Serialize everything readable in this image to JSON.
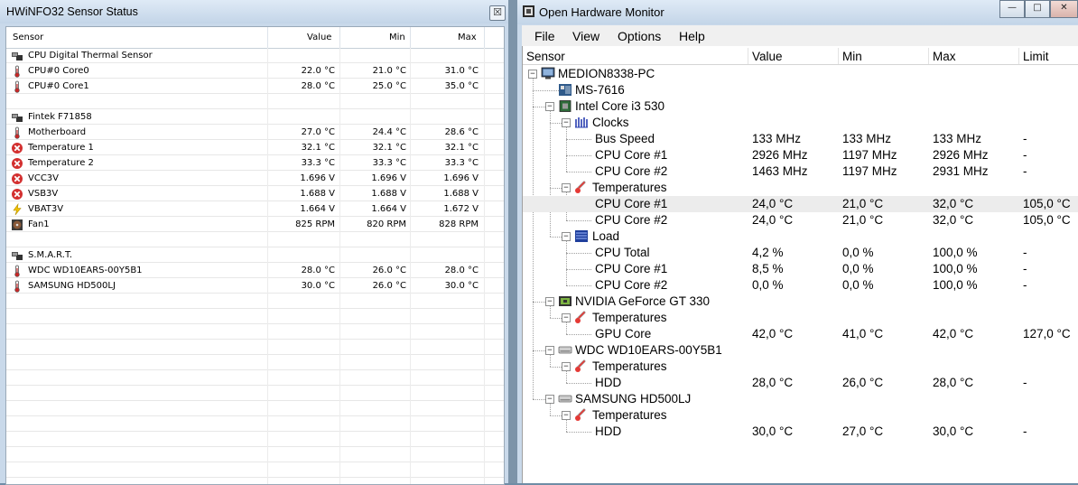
{
  "hwinfo": {
    "title": "HWiNFO32 Sensor Status",
    "close_glyph": "☒",
    "columns": [
      "Sensor",
      "Value",
      "Min",
      "Max"
    ],
    "rows": [
      {
        "icon": "chip-group-icon",
        "name": "CPU Digital Thermal Sensor",
        "value": "",
        "min": "",
        "max": ""
      },
      {
        "icon": "thermometer-icon",
        "name": "CPU#0 Core0",
        "value": "22.0 °C",
        "min": "21.0 °C",
        "max": "31.0 °C"
      },
      {
        "icon": "thermometer-icon",
        "name": "CPU#0 Core1",
        "value": "28.0 °C",
        "min": "25.0 °C",
        "max": "35.0 °C"
      },
      {
        "icon": "",
        "name": "",
        "value": "",
        "min": "",
        "max": ""
      },
      {
        "icon": "chip-group-icon",
        "name": "Fintek F71858",
        "value": "",
        "min": "",
        "max": ""
      },
      {
        "icon": "thermometer-icon",
        "name": "Motherboard",
        "value": "27.0 °C",
        "min": "24.4 °C",
        "max": "28.6 °C"
      },
      {
        "icon": "alert-icon",
        "name": "Temperature 1",
        "value": "32.1 °C",
        "min": "32.1 °C",
        "max": "32.1 °C"
      },
      {
        "icon": "alert-icon",
        "name": "Temperature 2",
        "value": "33.3 °C",
        "min": "33.3 °C",
        "max": "33.3 °C"
      },
      {
        "icon": "alert-icon",
        "name": "VCC3V",
        "value": "1.696 V",
        "min": "1.696 V",
        "max": "1.696 V"
      },
      {
        "icon": "alert-icon",
        "name": "VSB3V",
        "value": "1.688 V",
        "min": "1.688 V",
        "max": "1.688 V"
      },
      {
        "icon": "voltage-icon",
        "name": "VBAT3V",
        "value": "1.664 V",
        "min": "1.664 V",
        "max": "1.672 V"
      },
      {
        "icon": "fan-icon",
        "name": "Fan1",
        "value": "825 RPM",
        "min": "820 RPM",
        "max": "828 RPM"
      },
      {
        "icon": "",
        "name": "",
        "value": "",
        "min": "",
        "max": ""
      },
      {
        "icon": "chip-group-icon",
        "name": "S.M.A.R.T.",
        "value": "",
        "min": "",
        "max": ""
      },
      {
        "icon": "thermometer-icon",
        "name": "WDC WD10EARS-00Y5B1",
        "value": "28.0 °C",
        "min": "26.0 °C",
        "max": "28.0 °C"
      },
      {
        "icon": "thermometer-icon",
        "name": "SAMSUNG HD500LJ",
        "value": "30.0 °C",
        "min": "26.0 °C",
        "max": "30.0 °C"
      }
    ]
  },
  "ohm": {
    "title": "Open Hardware Monitor",
    "window_buttons": [
      "—",
      "□",
      "✕"
    ],
    "menu": [
      "File",
      "View",
      "Options",
      "Help"
    ],
    "columns": [
      "Sensor",
      "Value",
      "Min",
      "Max",
      "Limit"
    ],
    "rows": [
      {
        "level": 0,
        "expander": "−",
        "icon": "computer-icon",
        "name": "MEDION8338-PC",
        "value": "",
        "min": "",
        "max": "",
        "limit": "",
        "selected": false
      },
      {
        "level": 1,
        "expander": "",
        "icon": "mainboard-icon",
        "name": "MS-7616",
        "value": "",
        "min": "",
        "max": "",
        "limit": "",
        "selected": false
      },
      {
        "level": 1,
        "expander": "−",
        "icon": "cpu-icon",
        "name": "Intel Core i3 530",
        "value": "",
        "min": "",
        "max": "",
        "limit": "",
        "selected": false
      },
      {
        "level": 2,
        "expander": "−",
        "icon": "clock-icon",
        "name": "Clocks",
        "value": "",
        "min": "",
        "max": "",
        "limit": "",
        "selected": false
      },
      {
        "level": 3,
        "expander": "",
        "icon": "",
        "name": "Bus Speed",
        "value": "133 MHz",
        "min": "133 MHz",
        "max": "133 MHz",
        "limit": "-",
        "selected": false
      },
      {
        "level": 3,
        "expander": "",
        "icon": "",
        "name": "CPU Core #1",
        "value": "2926 MHz",
        "min": "1197 MHz",
        "max": "2926 MHz",
        "limit": "-",
        "selected": false
      },
      {
        "level": 3,
        "expander": "",
        "icon": "",
        "name": "CPU Core #2",
        "value": "1463 MHz",
        "min": "1197 MHz",
        "max": "2931 MHz",
        "limit": "-",
        "selected": false
      },
      {
        "level": 2,
        "expander": "−",
        "icon": "thermometer-icon",
        "name": "Temperatures",
        "value": "",
        "min": "",
        "max": "",
        "limit": "",
        "selected": false
      },
      {
        "level": 3,
        "expander": "",
        "icon": "",
        "name": "CPU Core #1",
        "value": "24,0 °C",
        "min": "21,0 °C",
        "max": "32,0 °C",
        "limit": "105,0 °C",
        "selected": true
      },
      {
        "level": 3,
        "expander": "",
        "icon": "",
        "name": "CPU Core #2",
        "value": "24,0 °C",
        "min": "21,0 °C",
        "max": "32,0 °C",
        "limit": "105,0 °C",
        "selected": false
      },
      {
        "level": 2,
        "expander": "−",
        "icon": "load-icon",
        "name": "Load",
        "value": "",
        "min": "",
        "max": "",
        "limit": "",
        "selected": false
      },
      {
        "level": 3,
        "expander": "",
        "icon": "",
        "name": "CPU Total",
        "value": "4,2 %",
        "min": "0,0 %",
        "max": "100,0 %",
        "limit": "-",
        "selected": false
      },
      {
        "level": 3,
        "expander": "",
        "icon": "",
        "name": "CPU Core #1",
        "value": "8,5 %",
        "min": "0,0 %",
        "max": "100,0 %",
        "limit": "-",
        "selected": false
      },
      {
        "level": 3,
        "expander": "",
        "icon": "",
        "name": "CPU Core #2",
        "value": "0,0 %",
        "min": "0,0 %",
        "max": "100,0 %",
        "limit": "-",
        "selected": false
      },
      {
        "level": 1,
        "expander": "−",
        "icon": "gpu-icon",
        "name": "NVIDIA GeForce GT 330",
        "value": "",
        "min": "",
        "max": "",
        "limit": "",
        "selected": false
      },
      {
        "level": 2,
        "expander": "−",
        "icon": "thermometer-icon",
        "name": "Temperatures",
        "value": "",
        "min": "",
        "max": "",
        "limit": "",
        "selected": false
      },
      {
        "level": 3,
        "expander": "",
        "icon": "",
        "name": "GPU Core",
        "value": "42,0 °C",
        "min": "41,0 °C",
        "max": "42,0 °C",
        "limit": "127,0 °C",
        "selected": false
      },
      {
        "level": 1,
        "expander": "−",
        "icon": "hdd-icon",
        "name": "WDC WD10EARS-00Y5B1",
        "value": "",
        "min": "",
        "max": "",
        "limit": "",
        "selected": false
      },
      {
        "level": 2,
        "expander": "−",
        "icon": "thermometer-icon",
        "name": "Temperatures",
        "value": "",
        "min": "",
        "max": "",
        "limit": "",
        "selected": false
      },
      {
        "level": 3,
        "expander": "",
        "icon": "",
        "name": "HDD",
        "value": "28,0 °C",
        "min": "26,0 °C",
        "max": "28,0 °C",
        "limit": "-",
        "selected": false
      },
      {
        "level": 1,
        "expander": "−",
        "icon": "hdd-icon",
        "name": "SAMSUNG HD500LJ",
        "value": "",
        "min": "",
        "max": "",
        "limit": "",
        "selected": false
      },
      {
        "level": 2,
        "expander": "−",
        "icon": "thermometer-icon",
        "name": "Temperatures",
        "value": "",
        "min": "",
        "max": "",
        "limit": "",
        "selected": false
      },
      {
        "level": 3,
        "expander": "",
        "icon": "",
        "name": "HDD",
        "value": "30,0 °C",
        "min": "27,0 °C",
        "max": "30,0 °C",
        "limit": "-",
        "selected": false
      }
    ]
  }
}
